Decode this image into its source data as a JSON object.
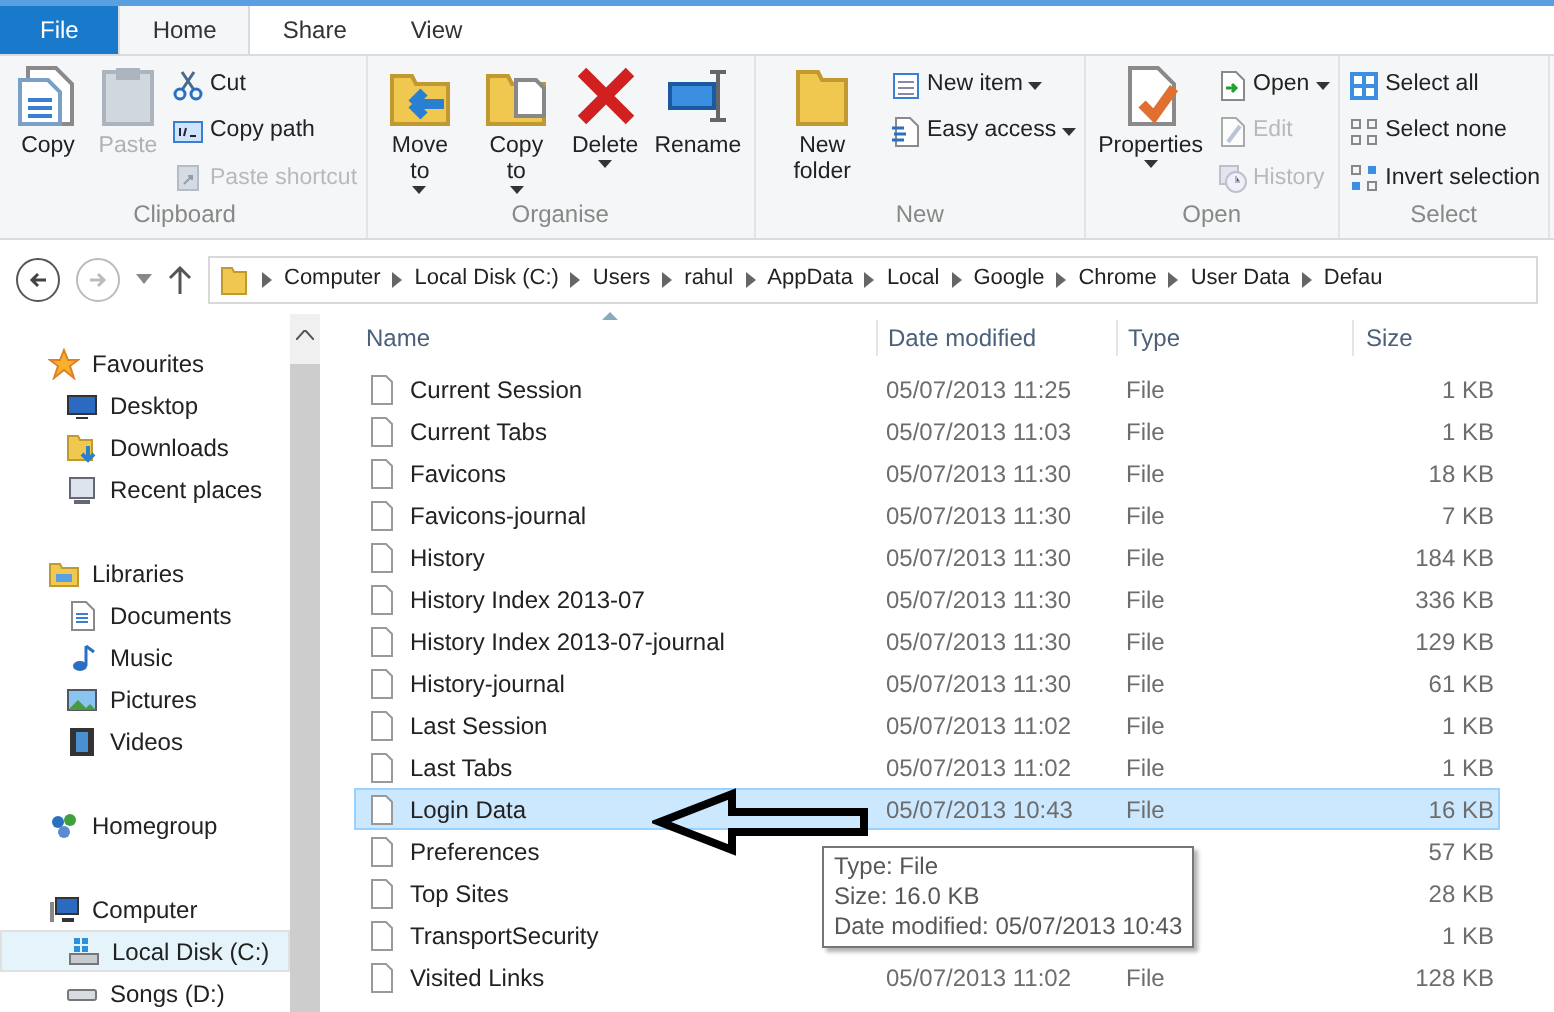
{
  "tabs": [
    {
      "label": "File",
      "kind": "file",
      "selected": false
    },
    {
      "label": "Home",
      "kind": "tab",
      "selected": true
    },
    {
      "label": "Share",
      "kind": "tab",
      "selected": false
    },
    {
      "label": "View",
      "kind": "tab",
      "selected": false
    }
  ],
  "ribbon": {
    "groups": [
      {
        "label": "Clipboard",
        "large": [
          {
            "label": "Copy",
            "disabled": false
          },
          {
            "label": "Paste",
            "disabled": true
          }
        ],
        "small": [
          {
            "label": "Cut",
            "disabled": false
          },
          {
            "label": "Copy path",
            "disabled": false
          },
          {
            "label": "Paste shortcut",
            "disabled": true
          }
        ]
      },
      {
        "label": "Organise",
        "large": [
          {
            "label": "Move to",
            "disabled": false,
            "dropdown": true
          },
          {
            "label": "Copy to",
            "disabled": false,
            "dropdown": true
          },
          {
            "label": "Delete",
            "disabled": false,
            "dropdown": true
          },
          {
            "label": "Rename",
            "disabled": false
          }
        ]
      },
      {
        "label": "New",
        "large": [
          {
            "label": "New folder",
            "disabled": false
          }
        ],
        "small": [
          {
            "label": "New item",
            "disabled": false,
            "dropdown": true
          },
          {
            "label": "Easy access",
            "disabled": false,
            "dropdown": true
          }
        ]
      },
      {
        "label": "Open",
        "large": [
          {
            "label": "Properties",
            "disabled": false,
            "dropdown": true
          }
        ],
        "small": [
          {
            "label": "Open",
            "disabled": false,
            "dropdown": true
          },
          {
            "label": "Edit",
            "disabled": true
          },
          {
            "label": "History",
            "disabled": true
          }
        ]
      },
      {
        "label": "Select",
        "small": [
          {
            "label": "Select all",
            "disabled": false
          },
          {
            "label": "Select none",
            "disabled": false
          },
          {
            "label": "Invert selection",
            "disabled": false
          }
        ]
      }
    ]
  },
  "address": {
    "breadcrumbs": [
      "Computer",
      "Local Disk (C:)",
      "Users",
      "rahul",
      "AppData",
      "Local",
      "Google",
      "Chrome",
      "User Data",
      "Defau"
    ]
  },
  "navigation": [
    {
      "label": "Favourites",
      "children": [
        {
          "label": "Desktop",
          "selected": false
        },
        {
          "label": "Downloads",
          "selected": false
        },
        {
          "label": "Recent places",
          "selected": false
        }
      ]
    },
    {
      "label": "Libraries",
      "children": [
        {
          "label": "Documents",
          "selected": false
        },
        {
          "label": "Music",
          "selected": false
        },
        {
          "label": "Pictures",
          "selected": false
        },
        {
          "label": "Videos",
          "selected": false
        }
      ]
    },
    {
      "label": "Homegroup"
    },
    {
      "label": "Computer",
      "children": [
        {
          "label": "Local Disk (C:)",
          "selected": true
        },
        {
          "label": "Songs (D:)",
          "selected": false
        }
      ]
    }
  ],
  "table": {
    "columns": [
      "Name",
      "Date modified",
      "Type",
      "Size"
    ],
    "rows": [
      {
        "name": "Current Session",
        "date": "05/07/2013 11:25",
        "type": "File",
        "size": "1 KB",
        "selected": false
      },
      {
        "name": "Current Tabs",
        "date": "05/07/2013 11:03",
        "type": "File",
        "size": "1 KB",
        "selected": false
      },
      {
        "name": "Favicons",
        "date": "05/07/2013 11:30",
        "type": "File",
        "size": "18 KB",
        "selected": false
      },
      {
        "name": "Favicons-journal",
        "date": "05/07/2013 11:30",
        "type": "File",
        "size": "7 KB",
        "selected": false
      },
      {
        "name": "History",
        "date": "05/07/2013 11:30",
        "type": "File",
        "size": "184 KB",
        "selected": false
      },
      {
        "name": "History Index 2013-07",
        "date": "05/07/2013 11:30",
        "type": "File",
        "size": "336 KB",
        "selected": false
      },
      {
        "name": "History Index 2013-07-journal",
        "date": "05/07/2013 11:30",
        "type": "File",
        "size": "129 KB",
        "selected": false
      },
      {
        "name": "History-journal",
        "date": "05/07/2013 11:30",
        "type": "File",
        "size": "61 KB",
        "selected": false
      },
      {
        "name": "Last Session",
        "date": "05/07/2013 11:02",
        "type": "File",
        "size": "1 KB",
        "selected": false
      },
      {
        "name": "Last Tabs",
        "date": "05/07/2013 11:02",
        "type": "File",
        "size": "1 KB",
        "selected": false
      },
      {
        "name": "Login Data",
        "date": "05/07/2013 10:43",
        "type": "File",
        "size": "16 KB",
        "selected": true
      },
      {
        "name": "Preferences",
        "size": "57 KB",
        "selected": false
      },
      {
        "name": "Top Sites",
        "size": "28 KB",
        "selected": false
      },
      {
        "name": "TransportSecurity",
        "size": "1 KB",
        "selected": false
      },
      {
        "name": "Visited Links",
        "date": "05/07/2013 11:02",
        "type": "File",
        "size": "128 KB",
        "selected": false
      }
    ]
  },
  "tooltip": {
    "lines": [
      "Type: File",
      "Size: 16.0 KB",
      "Date modified: 05/07/2013 10:43"
    ]
  }
}
